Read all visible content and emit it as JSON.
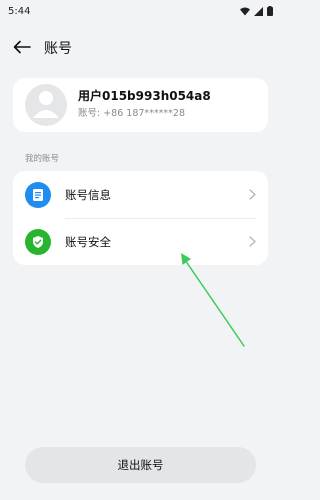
{
  "status_bar": {
    "time": "5:44",
    "icons": [
      "wifi-icon",
      "signal-icon",
      "battery-icon"
    ]
  },
  "header": {
    "title": "账号",
    "back_icon": "arrow-left-icon"
  },
  "profile": {
    "username": "用户015b993h054a8",
    "account_label": "账号: +86 187******28",
    "avatar_icon": "person-icon"
  },
  "section": {
    "label": "我的账号"
  },
  "menu": {
    "items": [
      {
        "label": "账号信息",
        "icon": "document-icon",
        "icon_color": "#1e8cf0"
      },
      {
        "label": "账号安全",
        "icon": "shield-check-icon",
        "icon_color": "#27b52f"
      }
    ]
  },
  "logout": {
    "label": "退出账号"
  },
  "colors": {
    "background": "#f1f3f5",
    "card": "#ffffff",
    "annotation_arrow": "#3ccb5a"
  }
}
